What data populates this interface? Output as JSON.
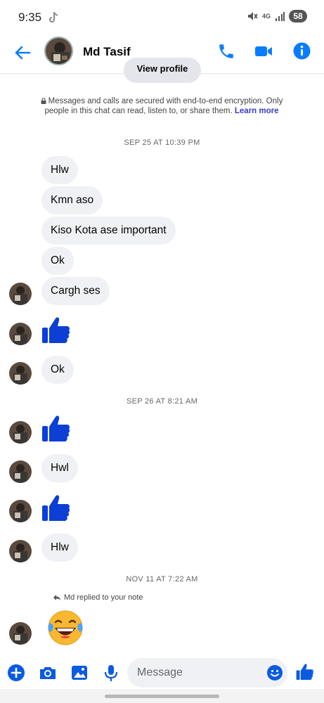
{
  "status_bar": {
    "time": "9:35",
    "network": "4G",
    "battery": "58"
  },
  "header": {
    "contact_name": "Md Tasif"
  },
  "chat": {
    "view_profile_label": "View profile",
    "encryption_text": "Messages and calls are secured with end-to-end encryption. Only people in this chat can read, listen to, or share them.",
    "encryption_link": "Learn more",
    "date_1": "SEP 25 AT 10:39 PM",
    "date_2": "SEP 26 AT 8:21 AM",
    "date_3": "NOV 11 AT 7:22 AM",
    "messages": [
      "Hlw",
      "Kmn aso",
      "Kiso Kota ase important",
      "Ok",
      "Cargh ses",
      "Ok",
      "Hwl",
      "Hlw"
    ],
    "reply_note": "Md replied to your note"
  },
  "composer": {
    "placeholder": "Message"
  },
  "colors": {
    "accent": "#0a7cff",
    "thumb": "#0b3fd6",
    "bubble": "#f0f1f5"
  }
}
